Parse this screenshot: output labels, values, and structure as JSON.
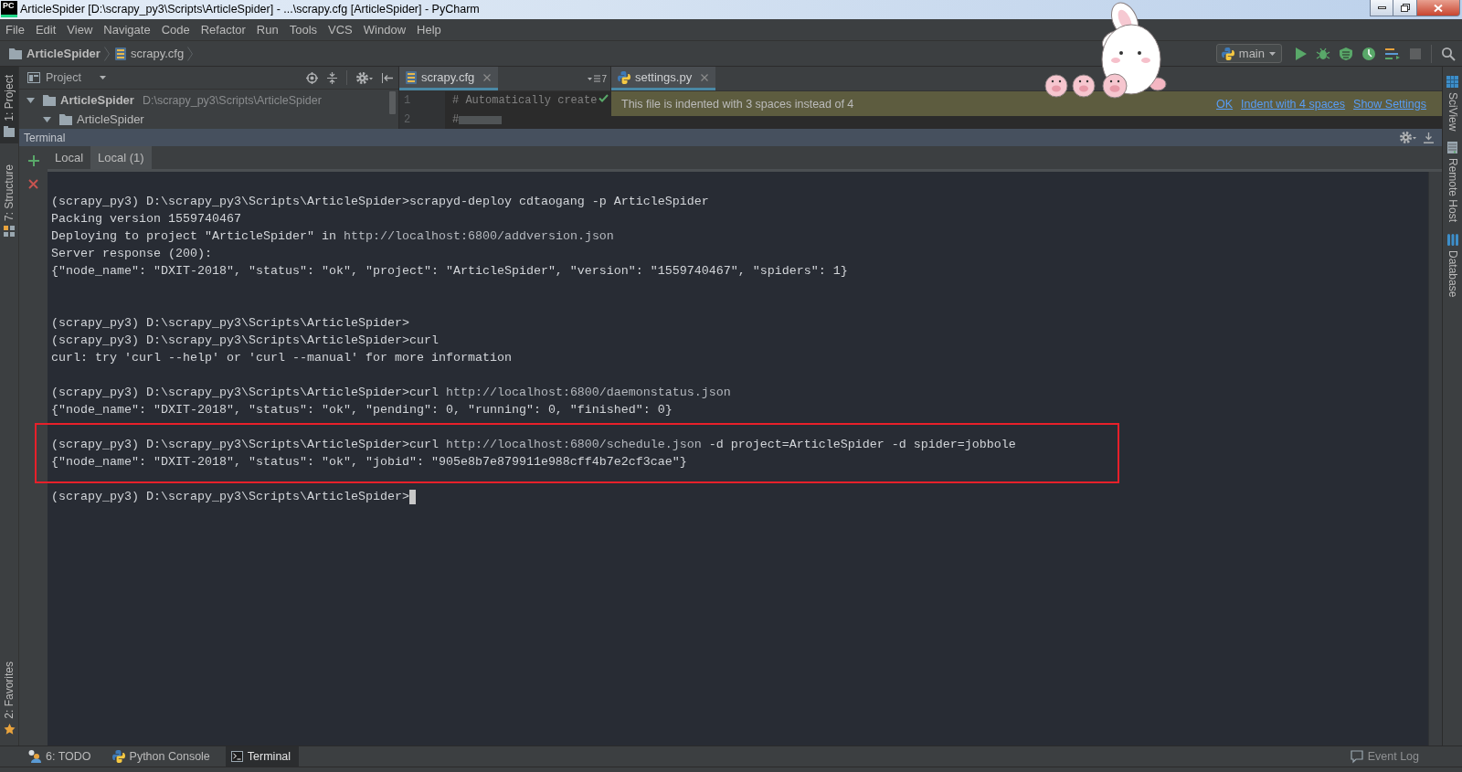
{
  "window": {
    "logo": "PC",
    "title": "ArticleSpider [D:\\scrapy_py3\\Scripts\\ArticleSpider] - ...\\scrapy.cfg [ArticleSpider] - PyCharm"
  },
  "menu": [
    "File",
    "Edit",
    "View",
    "Navigate",
    "Code",
    "Refactor",
    "Run",
    "Tools",
    "VCS",
    "Window",
    "Help"
  ],
  "breadcrumb": [
    {
      "label": "ArticleSpider",
      "kind": "folder"
    },
    {
      "label": "scrapy.cfg",
      "kind": "config"
    }
  ],
  "run_config": {
    "label": "main"
  },
  "left_tools": {
    "top": [
      {
        "label": "1: Project",
        "kind": "project",
        "selected": true
      },
      {
        "label": "7: Structure",
        "kind": "structure",
        "selected": false
      }
    ],
    "bottom": [
      {
        "label": "2: Favorites",
        "kind": "favorites",
        "selected": false
      }
    ]
  },
  "right_tools": [
    {
      "label": "SciView",
      "kind": "sciview"
    },
    {
      "label": "Remote Host",
      "kind": "remote"
    },
    {
      "label": "Database",
      "kind": "database"
    }
  ],
  "project_pane": {
    "title": "Project",
    "tree": [
      {
        "label": "ArticleSpider",
        "path": "D:\\scrapy_py3\\Scripts\\ArticleSpider",
        "expanded": true,
        "children": [
          {
            "label": "ArticleSpider",
            "expanded": true
          }
        ]
      }
    ]
  },
  "editors": [
    {
      "tabs": [
        {
          "label": "scrapy.cfg",
          "kind": "config",
          "selected": true
        }
      ],
      "hidden_tabs": "7",
      "lines": [
        {
          "number": "1",
          "text": "# Automatically create",
          "highlighted": false
        },
        {
          "number": "2",
          "text": "#",
          "highlighted": true
        }
      ]
    },
    {
      "tabs": [
        {
          "label": "settings.py",
          "kind": "python",
          "selected": true
        }
      ],
      "notification": {
        "message": "This file is indented with 3 spaces instead of 4",
        "actions": [
          "OK",
          "Indent with 4 spaces",
          "Show Settings"
        ]
      }
    }
  ],
  "terminal": {
    "title": "Terminal",
    "tabs": [
      {
        "label": "Local",
        "selected": false
      },
      {
        "label": "Local (1)",
        "selected": true
      }
    ],
    "lines": [
      {
        "kind": "text",
        "text": "(scrapy_py3) D:\\scrapy_py3\\Scripts\\ArticleSpider>scrapyd-deploy cdtaogang -p ArticleSpider",
        "boxed": false
      },
      {
        "kind": "text",
        "text": "Packing version 1559740467",
        "boxed": false
      },
      {
        "kind": "text",
        "text": "Deploying to project \"ArticleSpider\" in ",
        "link": "http://localhost:6800/addversion.json",
        "boxed": false
      },
      {
        "kind": "text",
        "text": "Server response (200):",
        "boxed": false
      },
      {
        "kind": "text",
        "text": "{\"node_name\": \"DXIT-2018\", \"status\": \"ok\", \"project\": \"ArticleSpider\", \"version\": \"1559740467\", \"spiders\": 1}",
        "boxed": false
      },
      {
        "kind": "blank"
      },
      {
        "kind": "blank"
      },
      {
        "kind": "text",
        "text": "(scrapy_py3) D:\\scrapy_py3\\Scripts\\ArticleSpider>",
        "boxed": false
      },
      {
        "kind": "text",
        "text": "(scrapy_py3) D:\\scrapy_py3\\Scripts\\ArticleSpider>curl",
        "boxed": false
      },
      {
        "kind": "text",
        "text": "curl: try 'curl --help' or 'curl --manual' for more information",
        "boxed": false
      },
      {
        "kind": "blank"
      },
      {
        "kind": "text",
        "text": "(scrapy_py3) D:\\scrapy_py3\\Scripts\\ArticleSpider>curl ",
        "link": "http://localhost:6800/daemonstatus.json",
        "boxed": false
      },
      {
        "kind": "text",
        "text": "{\"node_name\": \"DXIT-2018\", \"status\": \"ok\", \"pending\": 0, \"running\": 0, \"finished\": 0}",
        "boxed": false
      },
      {
        "kind": "blank"
      },
      {
        "kind": "text",
        "text": "(scrapy_py3) D:\\scrapy_py3\\Scripts\\ArticleSpider>curl ",
        "link": "http://localhost:6800/schedule.json",
        "after": " -d project=ArticleSpider -d spider=jobbole",
        "boxed": true
      },
      {
        "kind": "text",
        "text": "{\"node_name\": \"DXIT-2018\", \"status\": \"ok\", \"jobid\": \"905e8b7e879911e988cff4b7e2cf3cae\"}",
        "boxed": true
      },
      {
        "kind": "blank"
      },
      {
        "kind": "text",
        "text": "(scrapy_py3) D:\\scrapy_py3\\Scripts\\ArticleSpider>",
        "boxed": false
      }
    ],
    "cursor": true
  },
  "bottom_tools": [
    {
      "label": "6: TODO",
      "kind": "todo",
      "selected": false
    },
    {
      "label": "Python Console",
      "kind": "python",
      "selected": false
    },
    {
      "label": "Terminal",
      "kind": "terminal",
      "selected": true
    }
  ],
  "event_log": {
    "label": "Event Log"
  }
}
